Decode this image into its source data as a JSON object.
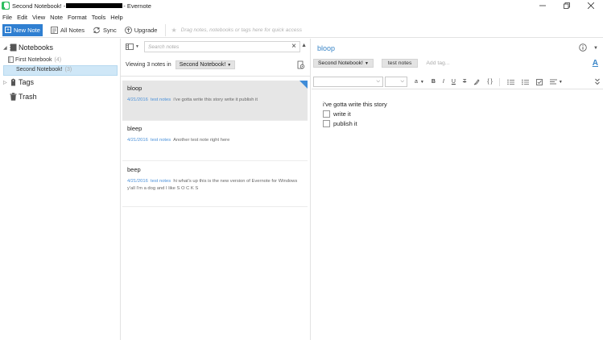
{
  "window": {
    "title_prefix": "Second Notebook! -",
    "title_suffix": "- Evernote"
  },
  "menu": [
    "File",
    "Edit",
    "View",
    "Note",
    "Format",
    "Tools",
    "Help"
  ],
  "toolbar": {
    "new_note": "New Note",
    "all_notes": "All Notes",
    "sync": "Sync",
    "upgrade": "Upgrade",
    "quick_access_placeholder": "Drag notes, notebooks or tags here for quick access"
  },
  "sidebar": {
    "notebooks_label": "Notebooks",
    "notebooks": [
      {
        "name": "First Notebook",
        "count": "(4)"
      },
      {
        "name": "Second Notebook!",
        "count": "(3)"
      }
    ],
    "tags_label": "Tags",
    "trash_label": "Trash"
  },
  "notelist": {
    "search_placeholder": "Search notes",
    "viewing_text": "Viewing 3 notes in",
    "notebook_chip": "Second Notebook!",
    "notes": [
      {
        "title": "bloop",
        "date": "4/21/2016",
        "tag": "test notes",
        "snippet": "i've gotta write this story write it publish it"
      },
      {
        "title": "bleep",
        "date": "4/21/2016",
        "tag": "test notes",
        "snippet": "Another test note right here"
      },
      {
        "title": "beep",
        "date": "4/21/2016",
        "tag": "test notes",
        "snippet": "hi what's up this is the new version of Evernote for Windows y'all I'm a dog and I like S O C K S"
      }
    ]
  },
  "editor": {
    "title": "bloop",
    "notebook": "Second Notebook!",
    "tag": "test notes",
    "add_tag_placeholder": "Add tag...",
    "body_line": "i've gotta write this story",
    "checklist": [
      "write it",
      "publish it"
    ]
  },
  "colors": {
    "accent": "#2f7fd1",
    "selection": "#cfe7f7",
    "link": "#4a90d9",
    "note_selected": "#e6e6e6"
  }
}
